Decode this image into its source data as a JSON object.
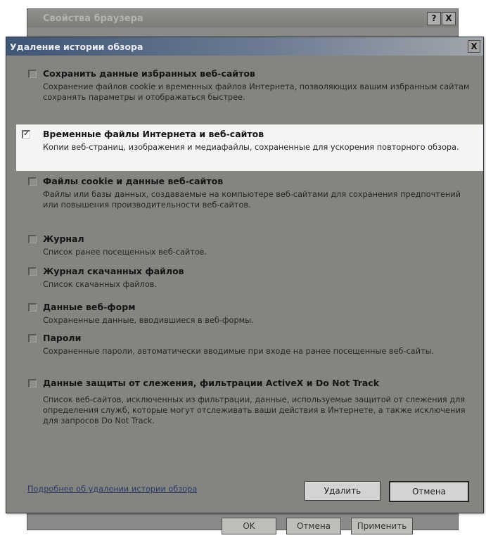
{
  "parent_window": {
    "title": "Свойства браузера",
    "help_label": "?",
    "close_label": "X",
    "ok_label": "OK",
    "cancel_label": "Отмена",
    "apply_label": "Применить"
  },
  "dialog": {
    "title": "Удаление истории обзора",
    "close_label": "X",
    "link_text": "Подробнее об удалении истории обзора",
    "delete_label": "Удалить",
    "cancel_label": "Отмена"
  },
  "options": [
    {
      "title": "Сохранить данные избранных веб-сайтов",
      "desc": "Сохранение файлов cookie и временных файлов Интернета, позволяющих вашим избранным сайтам сохранять параметры и отображаться быстрее.",
      "checked": false
    },
    {
      "title": "Временные файлы Интернета и веб-сайтов",
      "desc": "Копии веб-страниц, изображения и медиафайлы, сохраненные для ускорения повторного обзора.",
      "checked": true
    },
    {
      "title": "Файлы cookie и данные веб-сайтов",
      "desc": "Файлы или базы данных, создаваемые на компьютере веб-сайтами для сохранения предпочтений или повышения производительности веб-сайтов.",
      "checked": false
    },
    {
      "title": "Журнал",
      "desc": "Список ранее посещенных веб-сайтов.",
      "checked": false
    },
    {
      "title": "Журнал скачанных файлов",
      "desc": "Список скачанных файлов.",
      "checked": false
    },
    {
      "title": "Данные веб-форм",
      "desc": "Сохраненные данные, вводившиеся в веб-формы.",
      "checked": false
    },
    {
      "title": "Пароли",
      "desc": "Сохраненные пароли, автоматически вводимые при входе на ранее посещенные веб-сайты.",
      "checked": false
    },
    {
      "title": "Данные защиты от слежения, фильтрации ActiveX и Do Not Track",
      "desc": "Список веб-сайтов, исключенных из фильтрации, данные, используемые защитой от слежения для определения служб, которые могут отслеживать ваши действия в Интернете, а также исключения для запросов Do Not Track.",
      "checked": false
    }
  ],
  "check_mark": "✓"
}
